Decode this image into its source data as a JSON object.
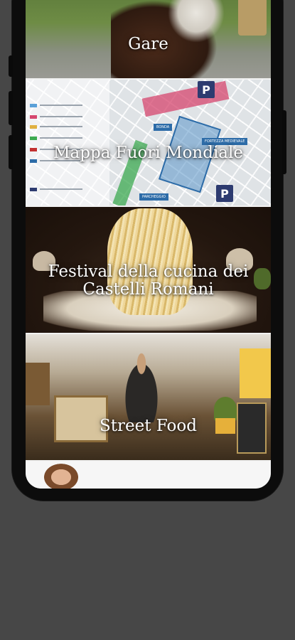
{
  "tiles": [
    {
      "id": "gare",
      "label": "Gare"
    },
    {
      "id": "map",
      "label": "Mappa Fuori Mondiale",
      "map": {
        "parking_letter": "P",
        "tags": [
          "BONDA",
          "FORTEZZA MEDIEVALE",
          "PARCHEGGIO"
        ]
      }
    },
    {
      "id": "pasta",
      "label": "Festival della cucina dei Castelli Romani"
    },
    {
      "id": "street",
      "label": "Street Food"
    },
    {
      "id": "next",
      "label": ""
    }
  ],
  "colors": {
    "background": "#474747",
    "phone_frame": "#0c0c0c",
    "map_zone_pink": "#d6466e",
    "map_zone_blue": "#2d6ca8",
    "map_zone_green": "#3caa50"
  }
}
